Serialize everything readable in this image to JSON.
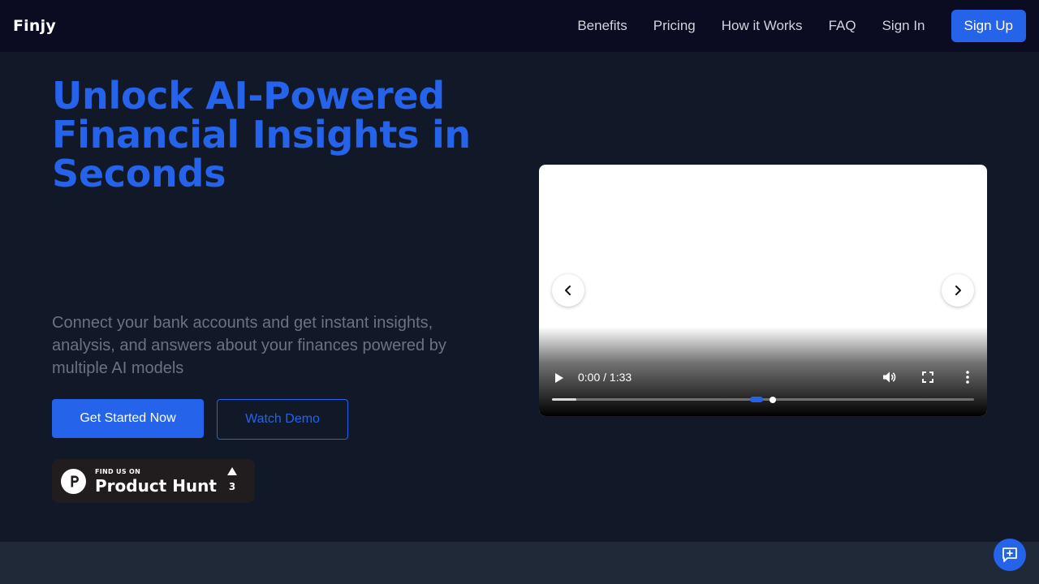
{
  "nav": {
    "brand": "Finjy",
    "links": [
      "Benefits",
      "Pricing",
      "How it Works",
      "FAQ",
      "Sign In"
    ],
    "signup": "Sign Up"
  },
  "hero": {
    "title": "Unlock AI-Powered Financial Insights in Seconds",
    "subtitle": "Connect your bank accounts and get instant insights, analysis, and answers about your finances powered by multiple AI models",
    "primary_cta": "Get Started Now",
    "secondary_cta": "Watch Demo"
  },
  "product_hunt": {
    "small": "FIND US ON",
    "big": "Product Hunt",
    "votes": "3"
  },
  "video": {
    "time": "0:00 / 1:33",
    "buffered_fraction": 0.058
  },
  "colors": {
    "accent": "#2563eb",
    "nav_bg": "#0b0b22",
    "page_bg": "#111827",
    "footer_bg": "#1f2937"
  }
}
